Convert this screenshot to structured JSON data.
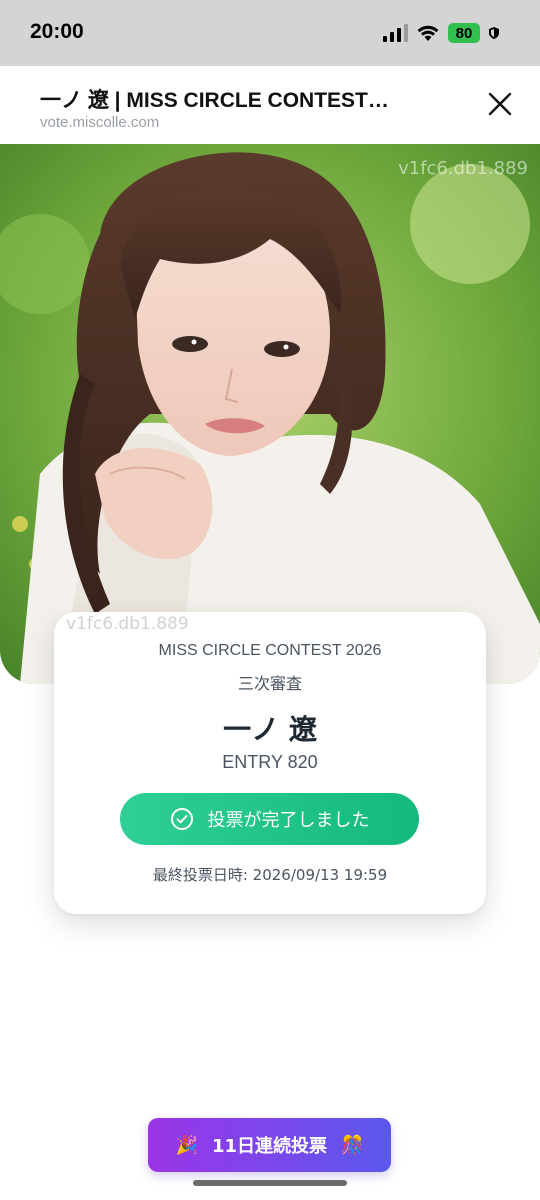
{
  "status_bar": {
    "time": "20:00",
    "battery_level": "80",
    "icons": [
      "signal-icon",
      "wifi-icon",
      "battery-icon",
      "shield-icon"
    ]
  },
  "browser": {
    "title": "一ノ 遼 | MISS CIRCLE CONTEST…",
    "url": "vote.miscolle.com",
    "close_icon": "close-icon"
  },
  "hero": {
    "watermark_top": "v1fc6.db1.889",
    "watermark_mid": "v1fc6.db1.889"
  },
  "card": {
    "contest_name": "MISS CIRCLE CONTEST 2026",
    "round": "三次審査",
    "candidate_name": "一ノ 遼",
    "entry": "ENTRY 820",
    "vote_status_label": "投票が完了しました",
    "vote_status_icon": "check-circle-icon",
    "last_vote": "最終投票日時: 2026/09/13 19:59"
  },
  "streak": {
    "label": "11日連続投票",
    "left_icon": "🎉",
    "right_icon": "🎊"
  },
  "colors": {
    "accent_green": "#1bc184",
    "streak_purple": "#9b35e8",
    "streak_blue": "#5b58ec",
    "battery_green": "#31c04e"
  }
}
